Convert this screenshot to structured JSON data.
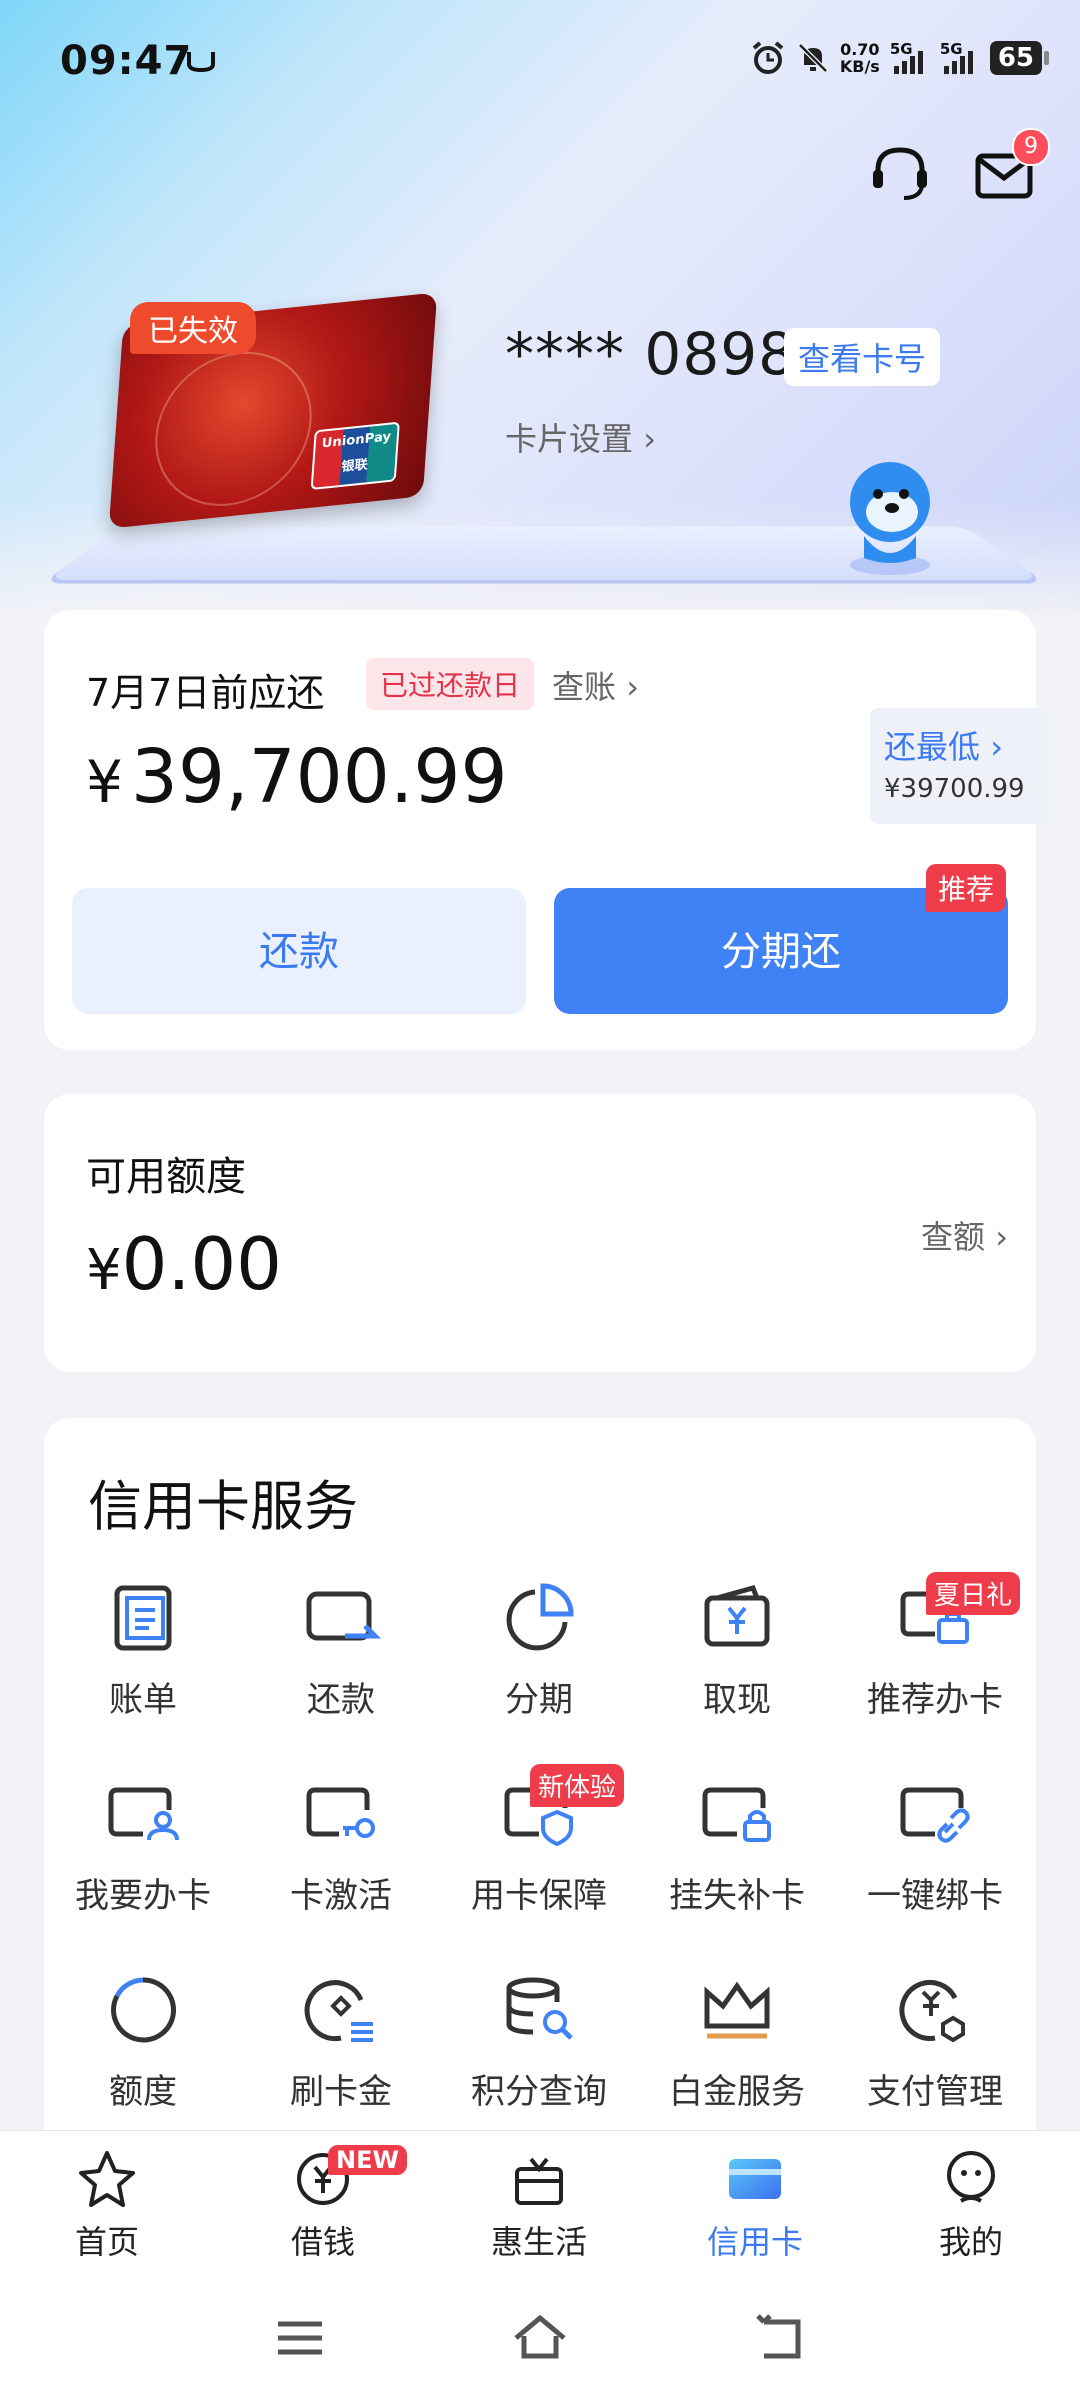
{
  "status_bar": {
    "time": "09:47",
    "net_speed_value": "0.70",
    "net_speed_unit": "KB/s",
    "sig1": "5G",
    "sig2": "5G",
    "battery": "65"
  },
  "header": {
    "message_badge": "9"
  },
  "card": {
    "status_tag": "已失效",
    "masked_number": "**** 0898",
    "view_number_btn": "查看卡号",
    "settings_link": "卡片设置",
    "unionpay_text": "UnionPay",
    "unionpay_cn": "银联"
  },
  "bill": {
    "due_label": "7月7日前应还",
    "overdue_tag": "已过还款日",
    "check_bill": "查账",
    "currency": "¥",
    "amount": "39,700.99",
    "min_label": "还最低",
    "min_value": "¥39700.99",
    "repay_btn": "还款",
    "installment_btn": "分期还",
    "recommend_tag": "推荐"
  },
  "limit": {
    "title": "可用额度",
    "currency": "¥",
    "value": "0.00",
    "check_limit": "查额"
  },
  "services": {
    "title": "信用卡服务",
    "items": [
      {
        "label": "账单",
        "icon": "bill-icon"
      },
      {
        "label": "还款",
        "icon": "repay-card-icon"
      },
      {
        "label": "分期",
        "icon": "installment-pie-icon"
      },
      {
        "label": "取现",
        "icon": "cash-wallet-icon"
      },
      {
        "label": "推荐办卡",
        "icon": "recommend-card-icon",
        "badge": "夏日礼"
      },
      {
        "label": "我要办卡",
        "icon": "apply-card-icon"
      },
      {
        "label": "卡激活",
        "icon": "activate-card-icon"
      },
      {
        "label": "用卡保障",
        "icon": "card-protection-icon",
        "badge": "新体验"
      },
      {
        "label": "挂失补卡",
        "icon": "lost-card-icon"
      },
      {
        "label": "一键绑卡",
        "icon": "bind-card-icon"
      },
      {
        "label": "额度",
        "icon": "limit-ring-icon"
      },
      {
        "label": "刷卡金",
        "icon": "swipe-reward-icon"
      },
      {
        "label": "积分查询",
        "icon": "points-query-icon"
      },
      {
        "label": "白金服务",
        "icon": "platinum-crown-icon"
      },
      {
        "label": "支付管理",
        "icon": "payment-manage-icon"
      }
    ]
  },
  "bottom_nav": {
    "items": [
      {
        "label": "首页",
        "icon": "star-home-icon"
      },
      {
        "label": "借钱",
        "icon": "borrow-money-icon",
        "badge": "NEW"
      },
      {
        "label": "惠生活",
        "icon": "gift-box-icon"
      },
      {
        "label": "信用卡",
        "icon": "credit-card-icon",
        "active": true
      },
      {
        "label": "我的",
        "icon": "profile-face-icon"
      }
    ]
  },
  "colors": {
    "accent": "#3f82f5",
    "alert": "#ee3c4b",
    "text_blue": "#3b7af0"
  }
}
